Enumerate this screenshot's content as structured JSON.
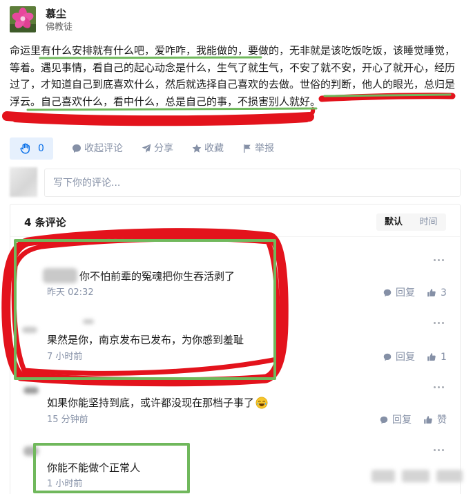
{
  "post": {
    "avatar_icon": "pink-flower-avatar",
    "author": {
      "name": "慕尘",
      "title": "佛教徒"
    },
    "lines": [
      "命运里有什么安排就有什么吧，爱咋咋，我能做的，要做的，无非就是该吃饭吃饭，该睡觉睡觉，",
      "等着。遇见事情，看自己的起心动念是什么，生气了就生气，不安了就不安，开心了就开心，经历",
      "过了，才知道自己到底喜欢什么，然后就选择自己喜欢的去做。世俗的判断，他人的眼光，总归是",
      "浮云。自己喜欢什么，看中什么，总是自己的事，不损害别人就好。"
    ]
  },
  "actions": {
    "clap": {
      "icon": "clap-icon",
      "count": "0"
    },
    "collapse_comments": {
      "icon": "comment-icon",
      "label": "收起评论"
    },
    "share": {
      "icon": "paper-plane-icon",
      "label": "分享"
    },
    "favorite": {
      "icon": "star-icon",
      "label": "收藏"
    },
    "report": {
      "icon": "flag-icon",
      "label": "举报"
    }
  },
  "comment_input": {
    "placeholder": "写下你的评论..."
  },
  "comments_panel": {
    "count_label": "4 条评论",
    "sort_tabs": [
      {
        "label": "默认",
        "active": true
      },
      {
        "label": "时间",
        "active": false
      }
    ]
  },
  "comments": [
    {
      "text": "你不怕前辈的冤魂把你生吞活剥了",
      "time": "昨天 02:32",
      "reply_label": "回复",
      "likes": "3"
    },
    {
      "text": "果然是你，南京发布已发布，为你感到羞耻",
      "time": "7 小时前",
      "reply_label": "回复",
      "likes": "1"
    },
    {
      "text": "如果你能坚持到底，或许都没现在那档子事了",
      "emoji_icon": "laughing-tears-emoji-icon",
      "time": "15 分钟前",
      "reply_label": "回复",
      "likes": "赞"
    },
    {
      "text": "你能不能做个正常人",
      "time": "1 小时前"
    }
  ],
  "colors": {
    "accent": "#056de8",
    "muted": "#8590a6",
    "text": "#1a1a1a",
    "annotation_red": "#e3131c",
    "annotation_green": "#70b85c"
  }
}
